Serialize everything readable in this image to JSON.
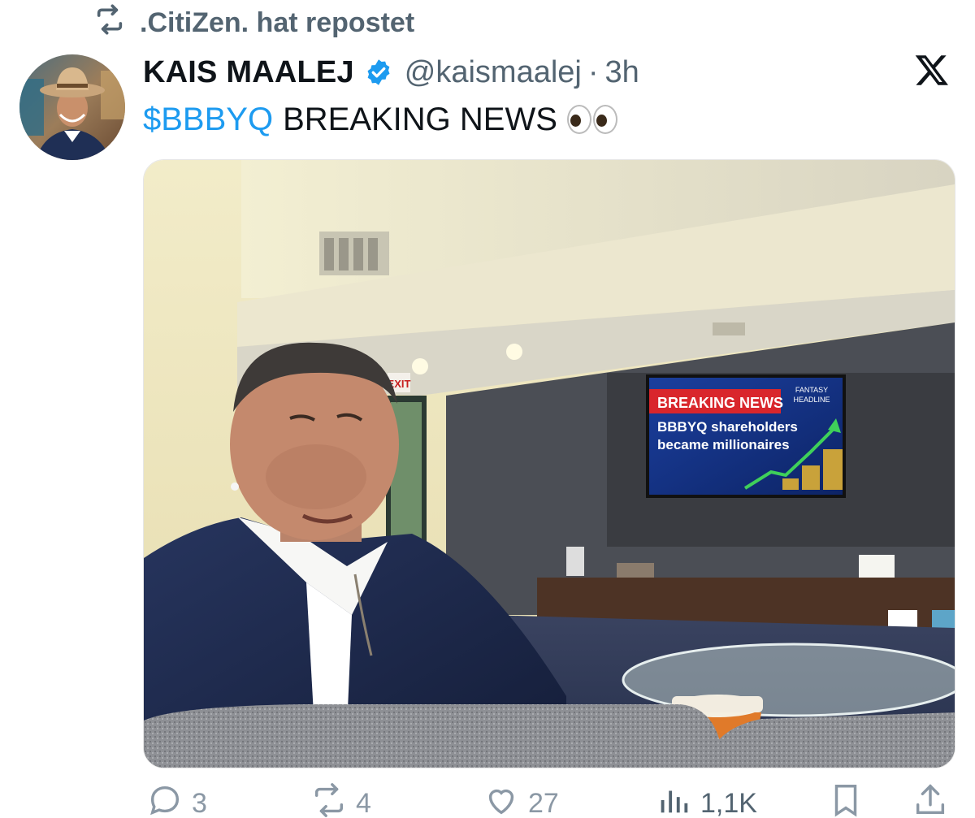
{
  "repost": {
    "icon": "repost-icon",
    "text": ".CitiZen. hat repostet"
  },
  "author": {
    "display_name": "KAIS MAALEJ",
    "verified": true,
    "handle": "@kaismaalej",
    "separator": "·",
    "time": "3h"
  },
  "tweet": {
    "cashtag": "$BBBYQ",
    "text": "BREAKING NEWS",
    "emoji": "eyes"
  },
  "media": {
    "tv_screen": {
      "banner": "BREAKING NEWS",
      "tag_line1": "FANTASY",
      "tag_line2": "HEADLINE",
      "headline_line1": "BBBYQ shareholders",
      "headline_line2": "became millionaires"
    },
    "exit_sign": "EXIT"
  },
  "actions": {
    "replies": "3",
    "reposts": "4",
    "likes": "27",
    "views": "1,1K"
  },
  "colors": {
    "accent": "#1d9bf0",
    "muted": "#536471",
    "banner_red": "#d9262c",
    "tv_blue": "#1a3f9a"
  }
}
